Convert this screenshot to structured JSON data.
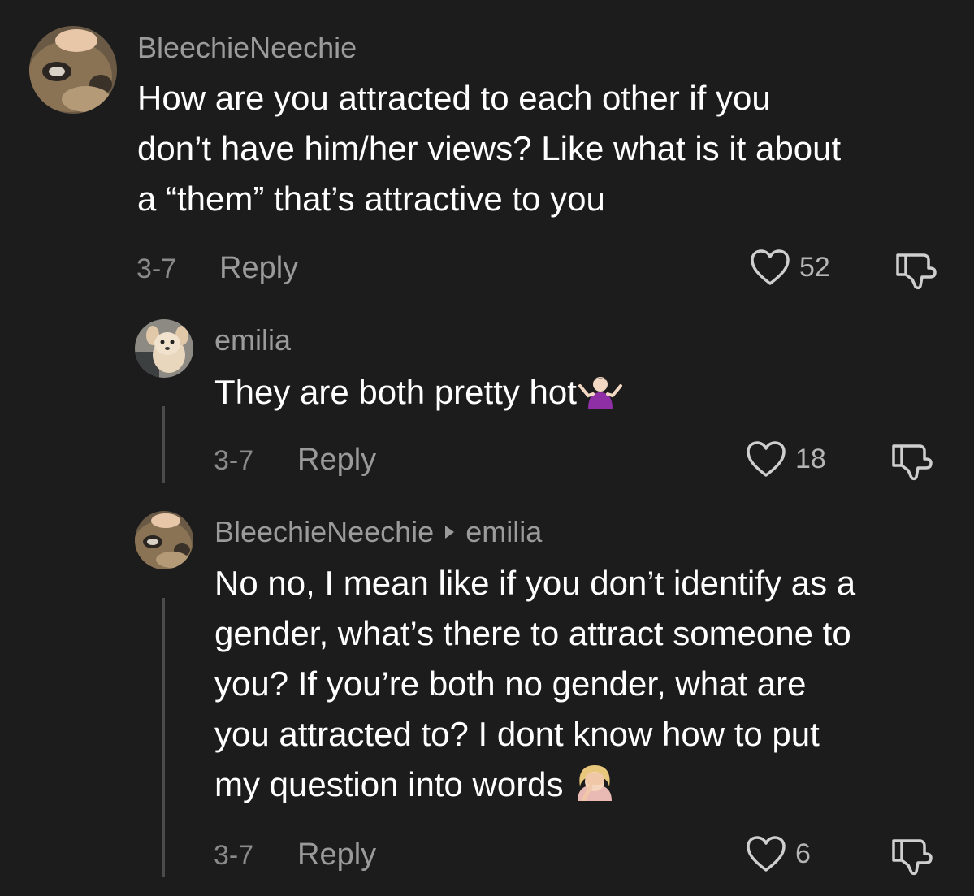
{
  "comments": [
    {
      "username": "BleechieNeechie",
      "lines": [
        "How are you attracted to each other if you",
        "don’t have him/her views? Like what is it about",
        "a “them” that’s attractive to you"
      ],
      "date": "3-7",
      "reply_label": "Reply",
      "likes": "52"
    },
    {
      "username": "emilia",
      "lines": [
        "They are both pretty hot"
      ],
      "emoji": "person-shrugging-emoji",
      "date": "3-7",
      "reply_label": "Reply",
      "likes": "18"
    },
    {
      "username": "BleechieNeechie",
      "reply_to": "emilia",
      "lines": [
        "No no, I mean like if you don’t identify as a",
        "gender, what’s there to attract someone to",
        "you? If you’re both no gender, what are",
        "you attracted to? I dont know how to put",
        "my question into words"
      ],
      "emoji": "face-palm-emoji",
      "date": "3-7",
      "reply_label": "Reply",
      "likes": "6"
    }
  ],
  "colors": {
    "background": "#1c1c1c",
    "text": "#ffffff",
    "muted": "#9b9b9b",
    "thread_line": "#4b4b4b"
  }
}
